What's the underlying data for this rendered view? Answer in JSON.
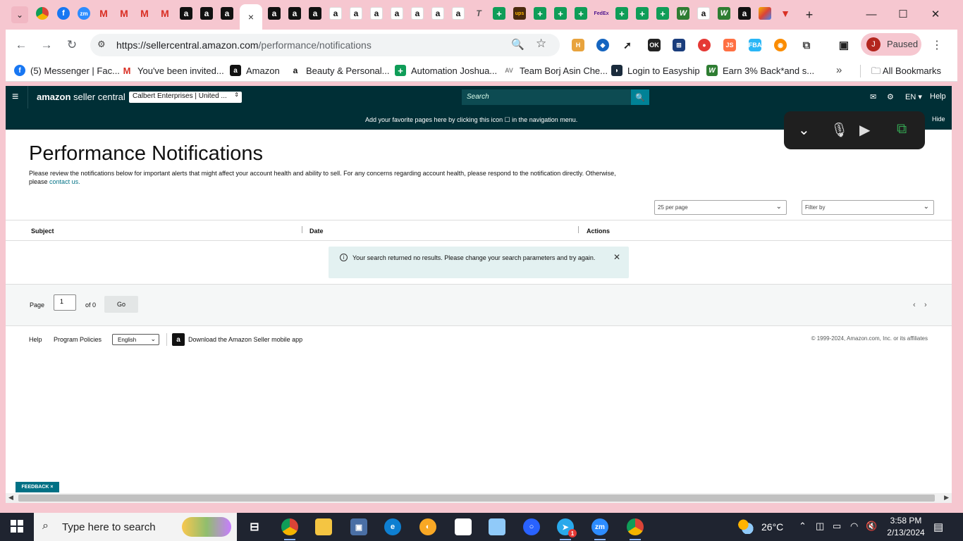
{
  "browser": {
    "active_tab_close": "×",
    "url_host": "https://sellercentral.amazon.com",
    "url_path": "/performance/notifications",
    "profile_initial": "J",
    "profile_label": "Paused"
  },
  "bookmarks": [
    {
      "label": "(5) Messenger | Fac...",
      "icon": "facebook-icon",
      "color": "#1877f2"
    },
    {
      "label": "You've been invited...",
      "icon": "gmail-icon",
      "color": "#d93025"
    },
    {
      "label": "Amazon",
      "icon": "amazon-icon",
      "color": "#111111"
    },
    {
      "label": "Beauty & Personal...",
      "icon": "amazon-smile-icon",
      "color": "#ffffff"
    },
    {
      "label": "Automation Joshua...",
      "icon": "sheets-icon",
      "color": "#0f9d58"
    },
    {
      "label": "Team Borj Asin Che...",
      "icon": "team-icon",
      "color": "#cccccc"
    },
    {
      "label": "Login to Easyship",
      "icon": "easyship-icon",
      "color": "#1a2b3c"
    },
    {
      "label": "Earn 3% Back*and s...",
      "icon": "w-icon",
      "color": "#2e7d32"
    }
  ],
  "all_bookmarks": "All Bookmarks",
  "seller": {
    "logo_bold": "amazon",
    "logo_rest": " seller central",
    "account": "Calbert Enterprises | United ...",
    "search_placeholder": "Search",
    "lang": "EN",
    "help": "Help",
    "banner_text": "Add your favorite pages here by clicking this icon ☐ in the navigation menu.",
    "hide": "Hide"
  },
  "main": {
    "title": "Performance Notifications",
    "description": "Please review the notifications below for important alerts that might affect your account health and ability to sell. For any concerns regarding account health, please respond to the notification directly. Otherwise, please",
    "contact_link": "contact us.",
    "per_page": "25 per page",
    "filter": "Filter by",
    "columns": [
      "Subject",
      "Date",
      "Actions"
    ],
    "alert": "Your search returned no results. Please change your search parameters and try again.",
    "page_label": "Page",
    "page_value": "1",
    "of_label": "of 0",
    "go": "Go"
  },
  "footer": {
    "help": "Help",
    "program_policies": "Program Policies",
    "language": "English",
    "app_download": "Download the Amazon Seller mobile app",
    "copyright": "© 1999-2024, Amazon.com, Inc. or its affiliates"
  },
  "feedback": "FEEDBACK ×",
  "taskbar": {
    "search_text": "Type here to search",
    "temperature": "26°C",
    "time": "3:58 PM",
    "date": "2/13/2024",
    "badge": "1"
  }
}
